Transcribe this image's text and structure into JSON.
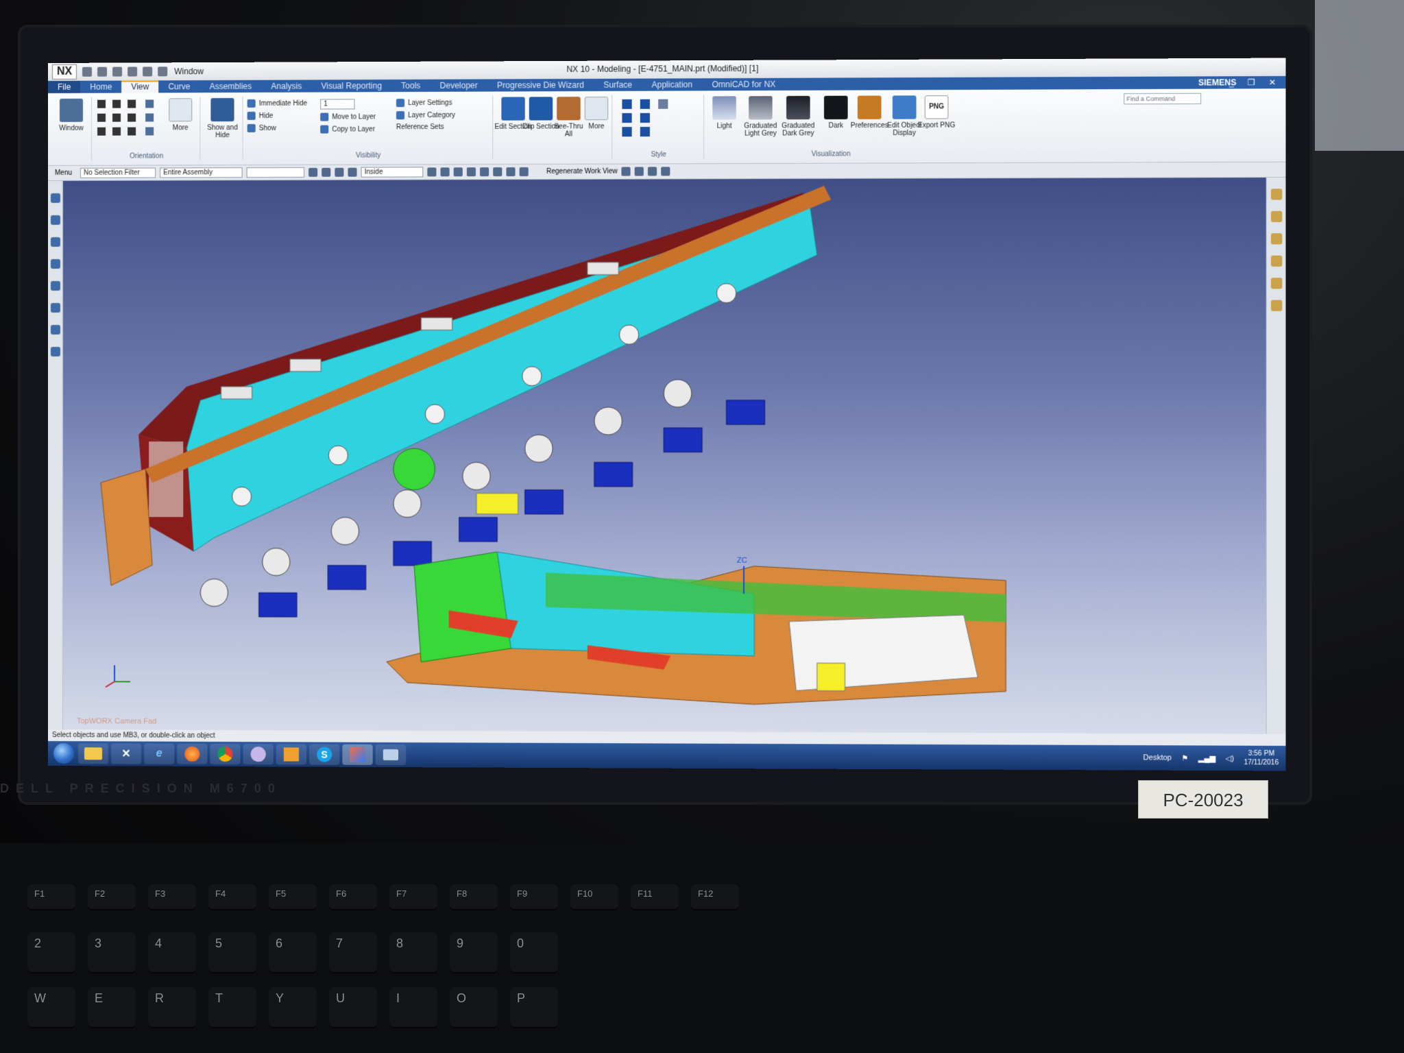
{
  "app": {
    "logo": "NX",
    "window_menu": "Window",
    "title": "NX 10 - Modeling - [E-4751_MAIN.prt (Modified)]  [1]",
    "brand": "SIEMENS",
    "window_controls": "_ ❐ ✕"
  },
  "tabs": [
    "File",
    "Home",
    "View",
    "Curve",
    "Assemblies",
    "Analysis",
    "Visual Reporting",
    "Tools",
    "Developer",
    "Progressive Die Wizard",
    "Surface",
    "Application",
    "OmniCAD for NX"
  ],
  "active_tab_index": 2,
  "ribbon": {
    "window_btn": "Window",
    "orientation_label": "Orientation",
    "more_label": "More",
    "show_and_hide": "Show and Hide",
    "immediate_hide": "Immediate Hide",
    "hide": "Hide",
    "show": "Show",
    "layer_value": "1",
    "move_to_layer": "Move to Layer",
    "copy_to_layer": "Copy to Layer",
    "layer_settings": "Layer Settings",
    "layer_category": "Layer Category",
    "reference_sets": "Reference Sets",
    "visibility_label": "Visibility",
    "edit_section": "Edit Section",
    "clip_section": "Clip Section",
    "see_thru_all": "See-Thru All",
    "more2": "More",
    "style_label": "Style",
    "light": "Light",
    "graduated_light_grey": "Graduated Light Grey",
    "graduated_dark_grey": "Graduated Dark Grey",
    "dark": "Dark",
    "preferences": "Preferences",
    "edit_object_display": "Edit Object Display",
    "export_png": "Export PNG",
    "png_badge": "PNG",
    "visualization_label": "Visualization",
    "find_command": "Find a Command"
  },
  "toolbar": {
    "menu": "Menu",
    "selection_filter": "No Selection Filter",
    "assembly_scope": "Entire Assembly",
    "snap_mode": "Inside",
    "regenerate": "Regenerate Work View"
  },
  "viewport": {
    "zc_label": "ZC",
    "watermark": "TopWORX Camera Fad"
  },
  "status": "Select objects and use MB3, or double-click an object",
  "taskbar": {
    "apps": [
      "folder",
      "tools",
      "e",
      "firefox",
      "chrome",
      "nx-camera",
      "outlook",
      "S",
      "nx",
      "monitor"
    ],
    "active_app": "nx",
    "desktop_label": "Desktop",
    "time": "3:56 PM",
    "date": "17/11/2016"
  },
  "hardware": {
    "brand": "DELL PRECISION M6700",
    "asset_tag": "PC-20023"
  },
  "colors": {
    "ribbon_blue": "#2c5fa8",
    "active_tab_accent": "#f7a21b",
    "model_cyan": "#2fd3e0",
    "model_maroon": "#7a1a1a",
    "model_orange": "#d9893b",
    "model_green": "#39d839",
    "model_blue": "#1b2fbf"
  }
}
